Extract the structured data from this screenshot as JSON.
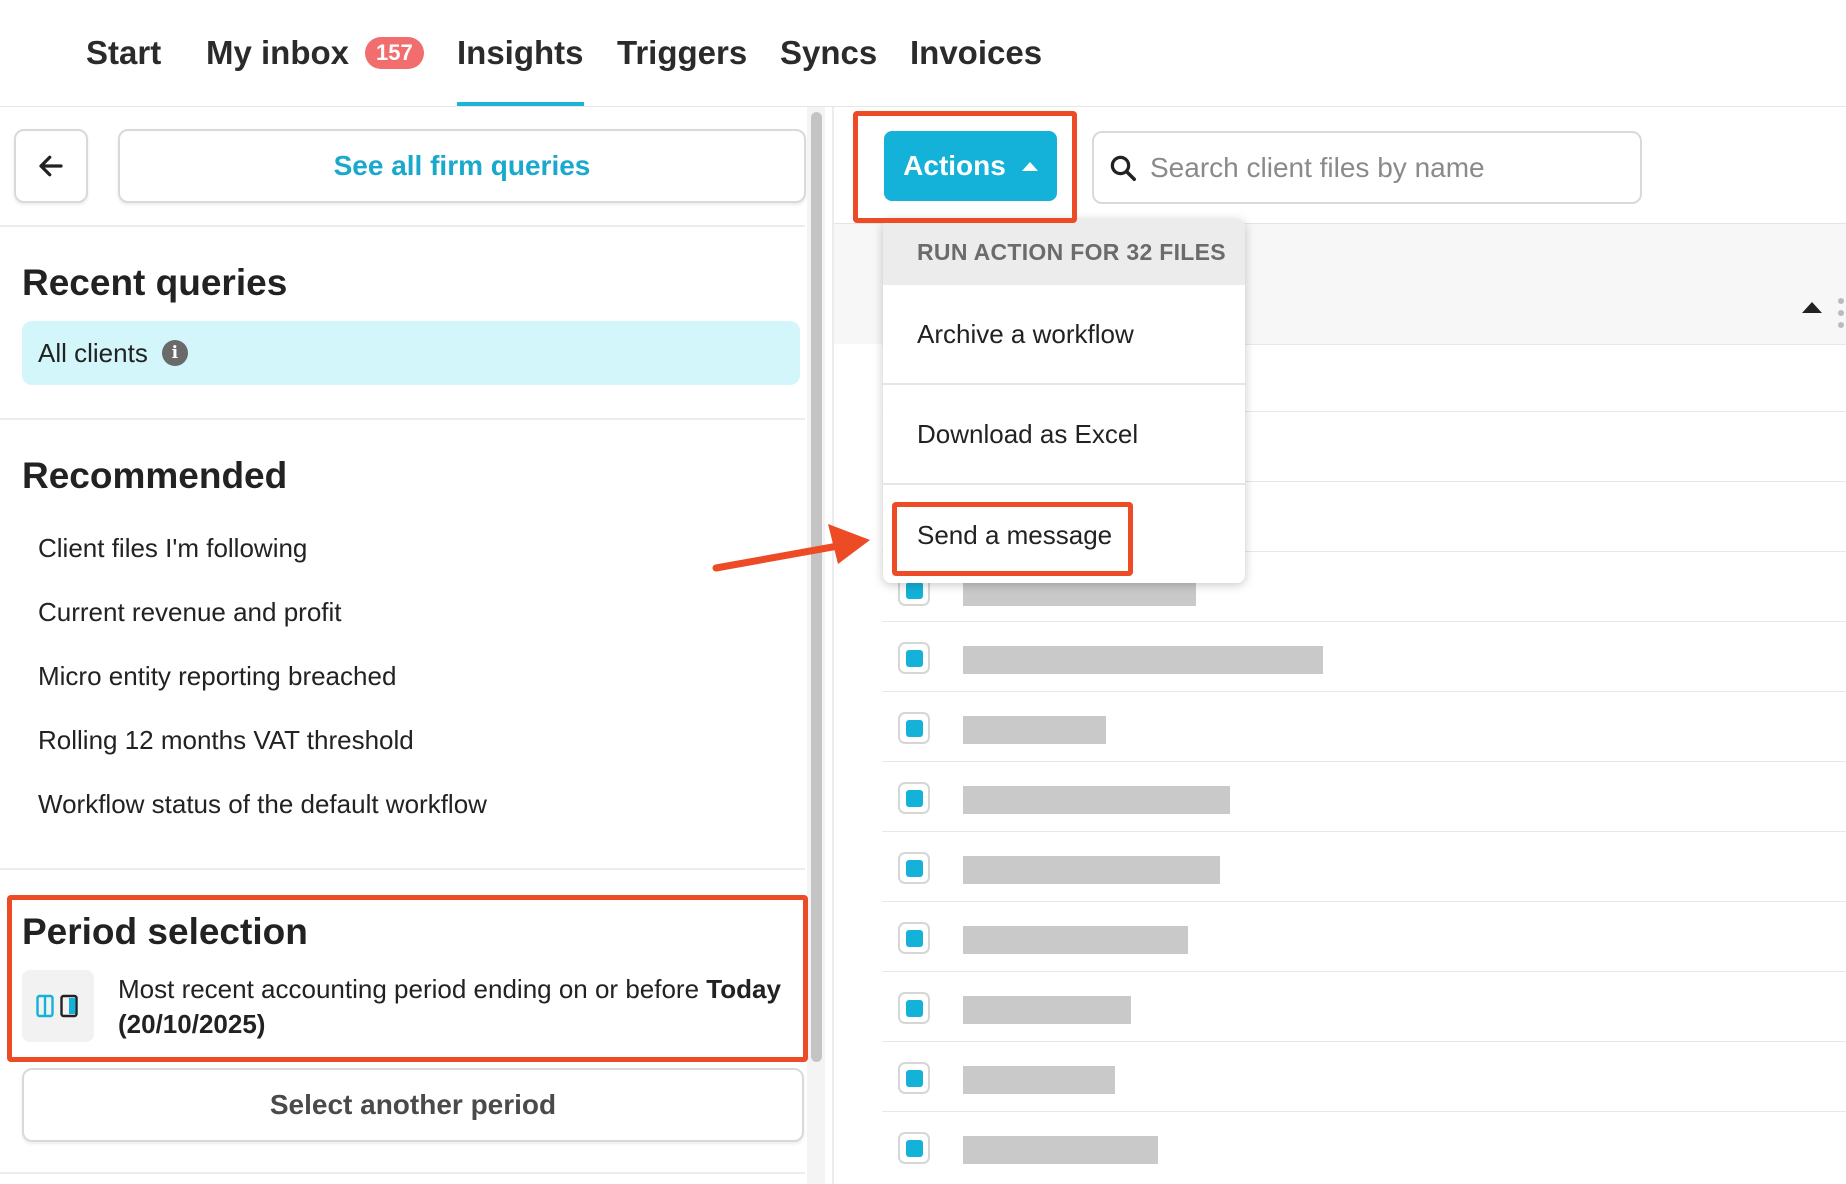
{
  "nav": {
    "items": [
      {
        "label": "Start"
      },
      {
        "label": "My inbox",
        "badge": "157"
      },
      {
        "label": "Insights",
        "active": true
      },
      {
        "label": "Triggers"
      },
      {
        "label": "Syncs"
      },
      {
        "label": "Invoices"
      }
    ]
  },
  "sidebar": {
    "back_icon": "arrow-left-icon",
    "see_all_label": "See all firm queries",
    "recent_title": "Recent queries",
    "recent_chip_label": "All clients",
    "recent_chip_info_glyph": "i",
    "recommended_title": "Recommended",
    "recommended_items": [
      "Client files I'm following",
      "Current revenue and profit",
      "Micro entity reporting breached",
      "Rolling 12 months VAT threshold",
      "Workflow status of the default workflow"
    ],
    "period_title": "Period selection",
    "period_icon": "period-columns-icon",
    "period_text_prefix": "Most recent accounting period ending on or before ",
    "period_text_bold": "Today (20/10/2025)",
    "select_period_label": "Select another period"
  },
  "toolbar": {
    "actions_label": "Actions",
    "search_placeholder": "Search client files by name"
  },
  "dropdown": {
    "header": "RUN ACTION FOR 32 FILES",
    "items": [
      "Archive a workflow",
      "Download as Excel",
      "Send a message"
    ]
  },
  "table": {
    "selected_rows": 9
  },
  "colors": {
    "accent": "#14b1d8",
    "badge": "#f26d6d",
    "highlight": "#ec4b26",
    "chip_bg": "#d3f6fb"
  }
}
